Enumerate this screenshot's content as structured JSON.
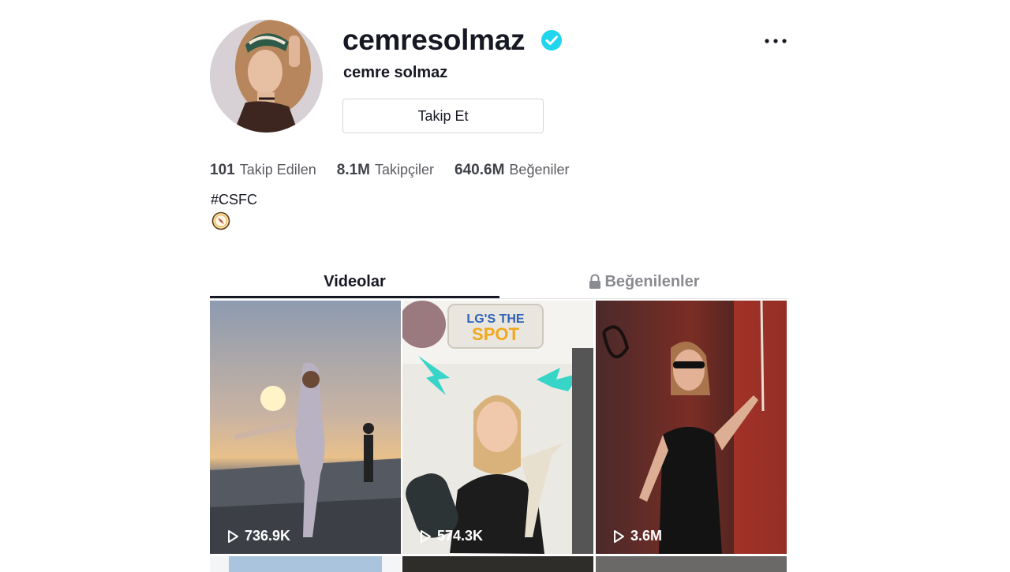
{
  "profile": {
    "username": "cemresolmaz",
    "nickname": "cemre solmaz",
    "verified": true,
    "follow_label": "Takip Et",
    "bio": "#CSFC",
    "bio_icon": "compass-emoji"
  },
  "stats": [
    {
      "value": "101",
      "label": "Takip Edilen"
    },
    {
      "value": "8.1M",
      "label": "Takipçiler"
    },
    {
      "value": "640.6M",
      "label": "Beğeniler"
    }
  ],
  "tabs": [
    {
      "label": "Videolar",
      "active": true
    },
    {
      "label": "Beğenilenler",
      "active": false,
      "icon": "lock-icon"
    }
  ],
  "videos": [
    {
      "views": "736.9K"
    },
    {
      "views": "574.3K",
      "overlay_text": "LG'S THE SPOT"
    },
    {
      "views": "3.6M"
    }
  ],
  "colors": {
    "verified": "#20d5ec",
    "text": "#161823",
    "muted": "#8a8b91"
  }
}
